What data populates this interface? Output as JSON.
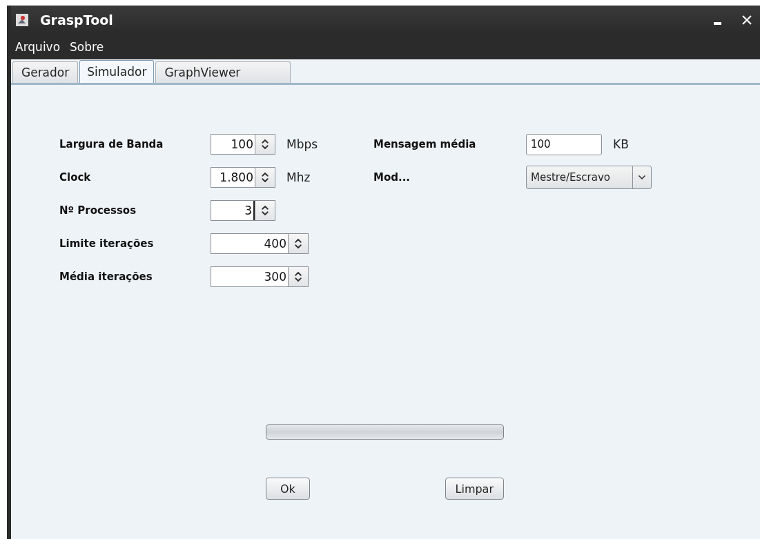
{
  "window": {
    "title": "GraspTool"
  },
  "menu": [
    "Arquivo",
    "Sobre"
  ],
  "tabs": [
    {
      "label": "Gerador",
      "selected": false
    },
    {
      "label": "Simulador",
      "selected": true
    },
    {
      "label": "GraphViewer",
      "selected": false
    }
  ],
  "left_fields": [
    {
      "label": "Largura de Banda",
      "value": "100",
      "unit": "Mbps",
      "focused": false
    },
    {
      "label": "Clock",
      "value": "1.800",
      "unit": "Mhz",
      "focused": false
    },
    {
      "label": "Nº Processos",
      "value": "3",
      "focused": true
    },
    {
      "label": "Limite iterações",
      "value": "400",
      "focused": false
    },
    {
      "label": "Média iterações",
      "value": "300",
      "focused": false
    }
  ],
  "right_fields": [
    {
      "label": "Mensagem média",
      "kind": "text",
      "value": "100",
      "unit": "KB"
    },
    {
      "label": "Mod...",
      "kind": "combo",
      "value": "Mestre/Escravo"
    }
  ],
  "progress": {
    "level": 0
  },
  "buttons": [
    "Ok",
    "Limpar"
  ]
}
